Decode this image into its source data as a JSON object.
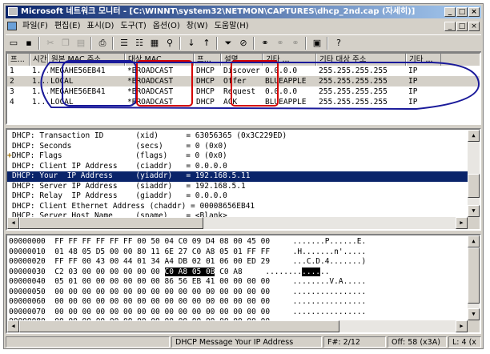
{
  "window": {
    "title": "Microsoft 네트워크 모니터 - [C:\\WINNT\\system32\\NETMON\\CAPTURES\\dhcp_2nd.cap (자세히)]"
  },
  "title_buttons": [
    "_",
    "□",
    "×"
  ],
  "menu": [
    "파일(F)",
    "편집(E)",
    "표시(D)",
    "도구(T)",
    "옵션(O)",
    "창(W)",
    "도움말(H)"
  ],
  "toolbar": [
    {
      "name": "new-icon",
      "glyph": "▭",
      "enabled": true
    },
    {
      "name": "save-icon",
      "glyph": "▪",
      "enabled": true
    },
    {
      "sep": true
    },
    {
      "name": "cut-icon",
      "glyph": "✂",
      "enabled": false
    },
    {
      "name": "copy-icon",
      "glyph": "❐",
      "enabled": false
    },
    {
      "name": "paste-icon",
      "glyph": "▤",
      "enabled": false
    },
    {
      "sep": true
    },
    {
      "name": "print-icon",
      "glyph": "⎙",
      "enabled": true
    },
    {
      "sep": true
    },
    {
      "name": "summary-pane-icon",
      "glyph": "☰",
      "enabled": true
    },
    {
      "name": "detail-pane-icon",
      "glyph": "☷",
      "enabled": true
    },
    {
      "name": "hex-pane-icon",
      "glyph": "▦",
      "enabled": true
    },
    {
      "name": "zoom-icon",
      "glyph": "⚲",
      "enabled": true
    },
    {
      "sep": true
    },
    {
      "name": "next-frame-icon",
      "glyph": "↓",
      "enabled": true
    },
    {
      "name": "previous-frame-icon",
      "glyph": "↑",
      "enabled": true
    },
    {
      "sep": true
    },
    {
      "name": "filter-icon",
      "glyph": "⏷",
      "enabled": true
    },
    {
      "name": "stop-filter-icon",
      "glyph": "⊘",
      "enabled": true
    },
    {
      "sep": true
    },
    {
      "name": "find-icon",
      "glyph": "⚭",
      "enabled": true
    },
    {
      "name": "find-next-icon",
      "glyph": "⚭",
      "enabled": false
    },
    {
      "name": "find-previous-icon",
      "glyph": "⚭",
      "enabled": false
    },
    {
      "sep": true
    },
    {
      "name": "display-icon",
      "glyph": "▣",
      "enabled": true
    },
    {
      "sep": true
    },
    {
      "name": "help-icon",
      "glyph": "?",
      "enabled": true
    }
  ],
  "summary": {
    "columns": [
      "프...",
      "시간",
      "원본 MAC 주소",
      "대상 MAC ...",
      "프...",
      "설명",
      "기타 ...",
      "기타 대상 주소",
      "기타 ..."
    ],
    "rows": [
      [
        "1",
        "1...",
        "MEGAHE56EB41",
        "*BROADCAST",
        "DHCP",
        "Discover",
        "0.0.0.0",
        "255.255.255.255",
        "IP"
      ],
      [
        "2",
        "1...",
        "LOCAL",
        "*BROADCAST",
        "DHCP",
        "Offer",
        "BLUEAPPLE",
        "255.255.255.255",
        "IP"
      ],
      [
        "3",
        "1...",
        "MEGAHE56EB41",
        "*BROADCAST",
        "DHCP",
        "Request",
        "0.0.0.0",
        "255.255.255.255",
        "IP"
      ],
      [
        "4",
        "1...",
        "LOCAL",
        "*BROADCAST",
        "DHCP",
        "ACK",
        "BLUEAPPLE",
        "255.255.255.255",
        "IP"
      ]
    ],
    "selected_row": 1
  },
  "detail": [
    "DHCP: Transaction ID       (xid)      = 63056365 (0x3C229ED)",
    "DHCP: Seconds              (secs)     = 0 (0x0)",
    "DHCP: Flags                (flags)    = 0 (0x0)",
    "DHCP: Client IP Address    (ciaddr)   = 0.0.0.0",
    "DHCP: Your  IP Address     (yiaddr)   = 192.168.5.11",
    "DHCP: Server IP Address    (siaddr)   = 192.168.5.1",
    "DHCP: Relay  IP Address    (giaddr)   = 0.0.0.0",
    "DHCP: Client Ethernet Address (chaddr) = 00008656EB41",
    "DHCP: Server Host Name     (sname)    = <Blank>"
  ],
  "detail_expand_symbol": "+",
  "detail_expanded_line": 2,
  "detail_selected_line": 4,
  "hex": [
    {
      "offset": "00000000",
      "bytes": "FF FF FF FF FF FF 00 50 04 C0 09 D4 08 00 45 00",
      "ascii": ".......P......E."
    },
    {
      "offset": "00000010",
      "bytes": "01 48 05 D5 00 00 80 11 6E 27 C0 A8 05 01 FF FF",
      "ascii": ".H.......n'....."
    },
    {
      "offset": "00000020",
      "bytes": "FF FF 00 43 00 44 01 34 A4 DB 02 01 06 00 ED 29",
      "ascii": "...C.D.4.......)"
    },
    {
      "offset": "00000030",
      "bytes_pre": "C2 03 00 00 00 00 00 00 ",
      "bytes_hl": "C0 A8 05 0B",
      "bytes_post": " C0 A8",
      "ascii_pre": "........",
      "ascii_hl": "....",
      "ascii_post": ".."
    },
    {
      "offset": "00000040",
      "bytes": "05 01 00 00 00 00 00 00 86 56 EB 41 00 00 00 00",
      "ascii": "........V.A....."
    },
    {
      "offset": "00000050",
      "bytes": "00 00 00 00 00 00 00 00 00 00 00 00 00 00 00 00",
      "ascii": "................"
    },
    {
      "offset": "00000060",
      "bytes": "00 00 00 00 00 00 00 00 00 00 00 00 00 00 00 00",
      "ascii": "................"
    },
    {
      "offset": "00000070",
      "bytes": "00 00 00 00 00 00 00 00 00 00 00 00 00 00 00 00",
      "ascii": "................"
    },
    {
      "offset": "00000080",
      "bytes": "00 00 00 00 00 00 00 00 00 00 00 00 00 00 00 00",
      "ascii": "................"
    }
  ],
  "status": {
    "message": "DHCP Message Your IP Address",
    "frame": "F#: 2/12",
    "offset": "Off: 58 (x3A)",
    "length": "L: 4 (x"
  },
  "colors": {
    "annotation_red": "#d40000",
    "annotation_blue": "#1a1a9a",
    "selection": "#0a246a"
  }
}
